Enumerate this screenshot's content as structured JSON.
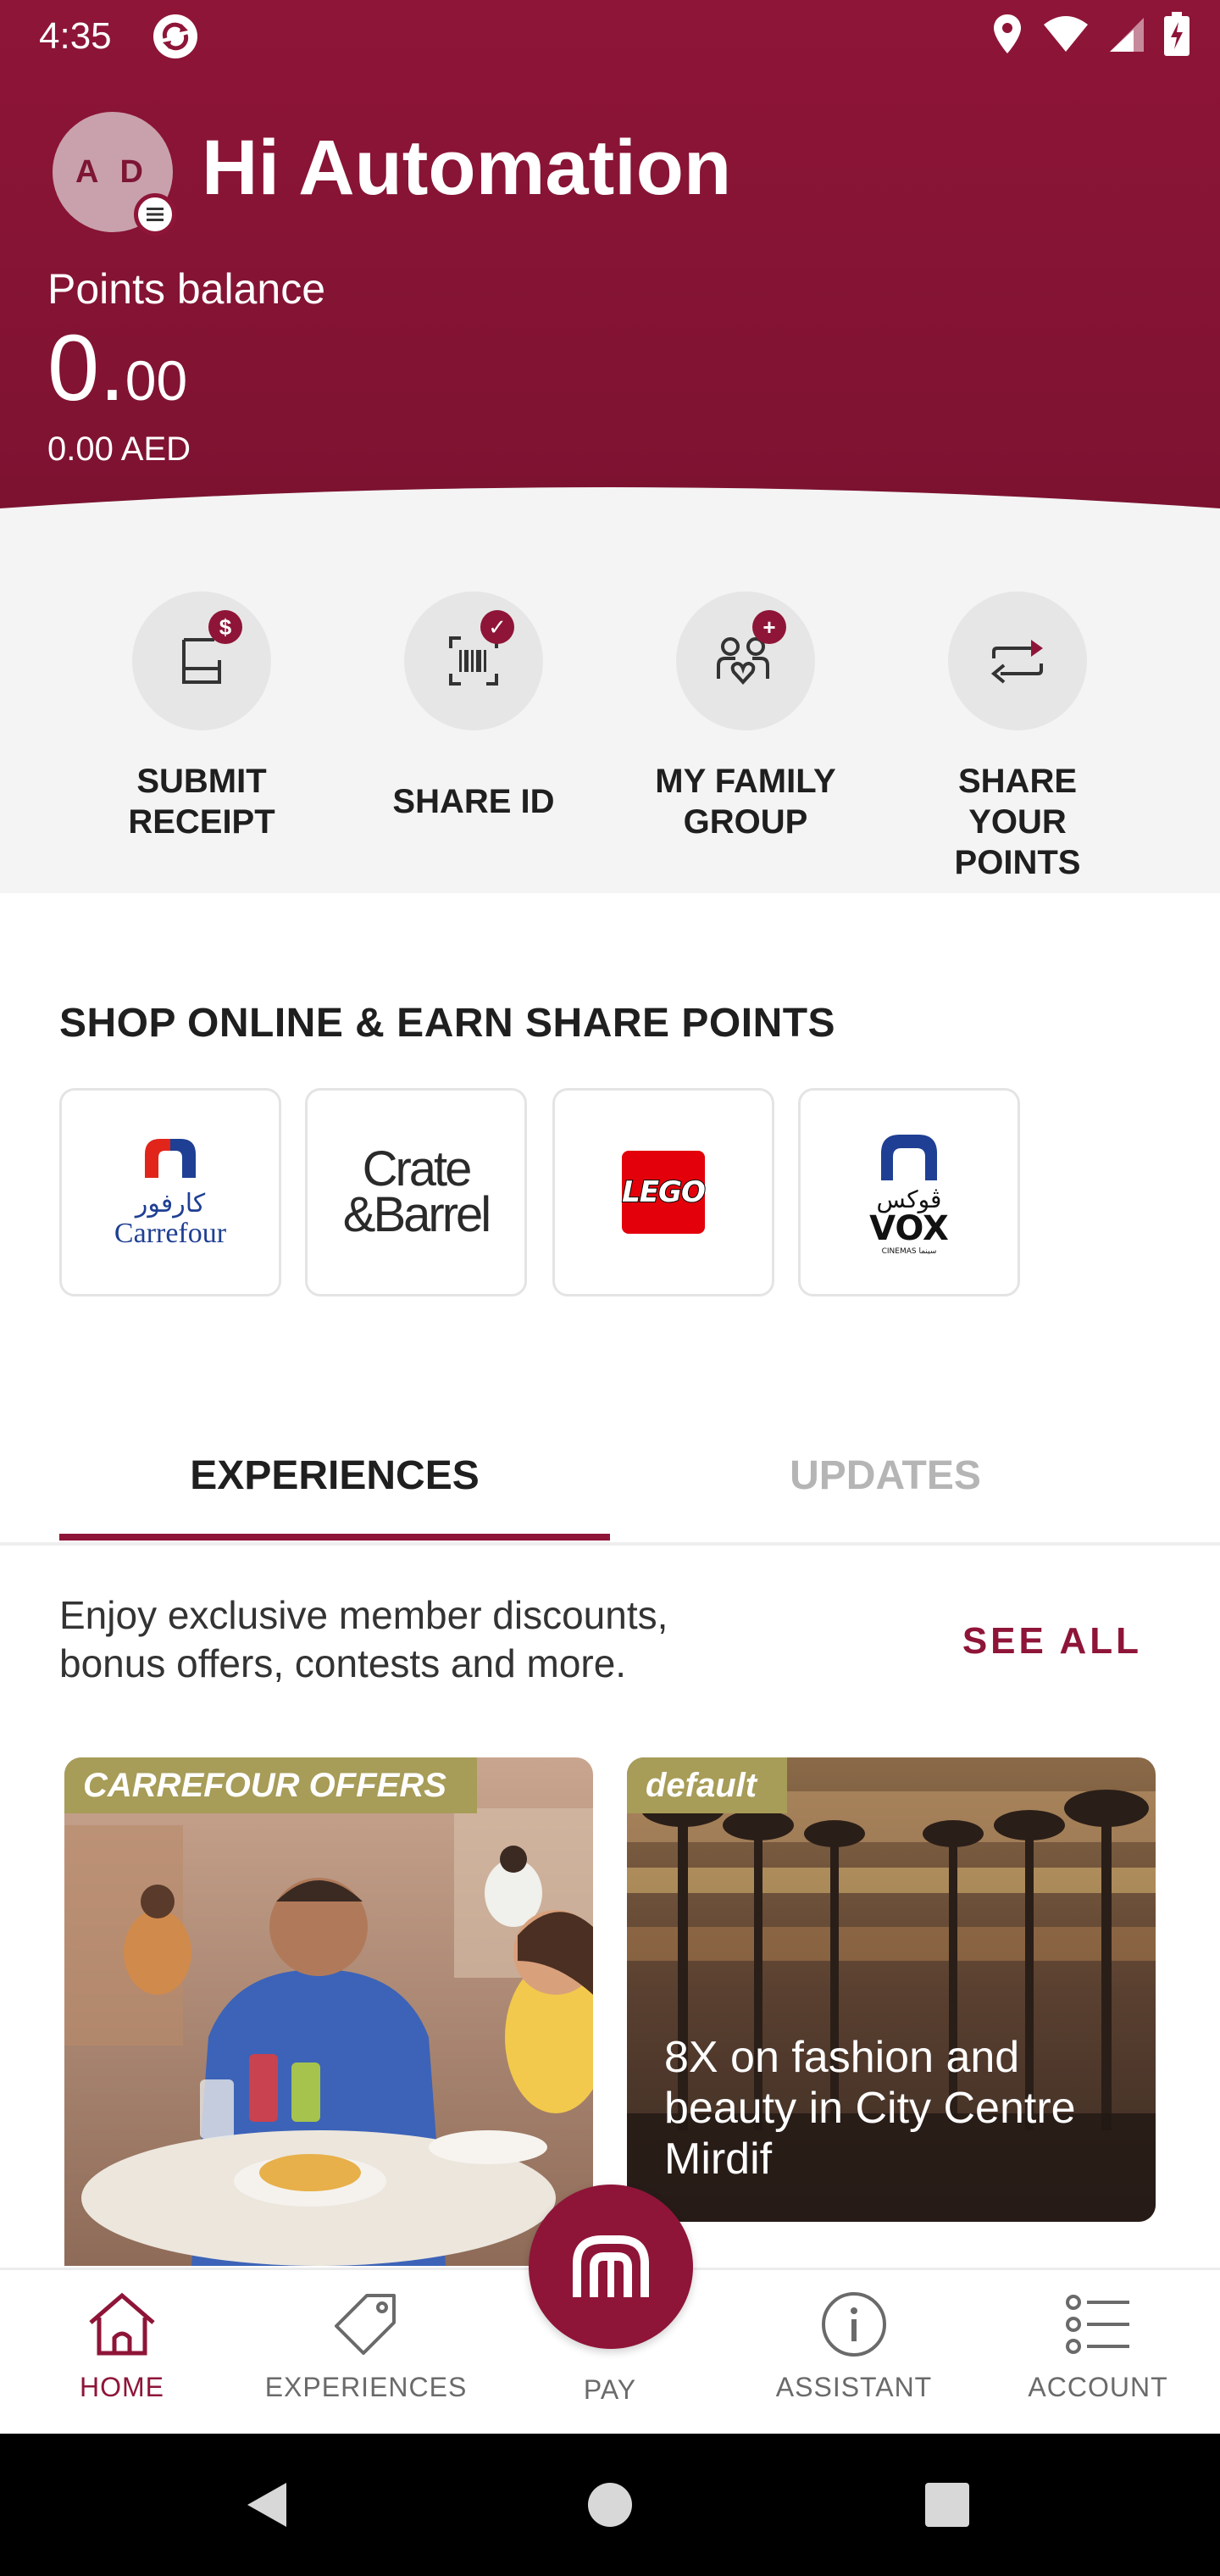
{
  "status_bar": {
    "time": "4:35"
  },
  "header": {
    "avatar_initials": "A D",
    "greeting": "Hi Automation",
    "points_label": "Points balance",
    "points_whole": "0.",
    "points_decimal": "00",
    "points_aed": "0.00 AED"
  },
  "actions": [
    {
      "label": "SUBMIT\nRECEIPT",
      "icon": "receipt-icon",
      "badge": "$"
    },
    {
      "label": "SHARE ID",
      "icon": "barcode-scan-icon",
      "badge": "✓"
    },
    {
      "label": "MY FAMILY\nGROUP",
      "icon": "family-icon",
      "badge": "+"
    },
    {
      "label": "SHARE YOUR\nPOINTS",
      "icon": "transfer-arrows-icon",
      "badge": ""
    }
  ],
  "shop": {
    "title": "SHOP ONLINE & EARN SHARE POINTS",
    "partners": [
      {
        "name": "Carrefour",
        "arabic": "كارفور"
      },
      {
        "name": "Crate&Barrel",
        "line1": "Crate",
        "line2": "&Barrel"
      },
      {
        "name": "LEGO"
      },
      {
        "name": "VOX",
        "arabic": "ڤوكس",
        "sub": "CINEMAS سينما"
      }
    ]
  },
  "tabs": {
    "active": "EXPERIENCES",
    "inactive": "UPDATES"
  },
  "experiences": {
    "description": "Enjoy exclusive member discounts, bonus offers, contests and more.",
    "see_all": "SEE ALL",
    "cards": [
      {
        "tag": "CARREFOUR OFFERS",
        "caption": ""
      },
      {
        "tag": "default",
        "caption": "8X on fashion and beauty in City Centre Mirdif"
      }
    ]
  },
  "bottom_nav": {
    "items": [
      {
        "label": "HOME",
        "active": true
      },
      {
        "label": "EXPERIENCES",
        "active": false
      },
      {
        "label": "PAY",
        "active": false
      },
      {
        "label": "ASSISTANT",
        "active": false
      },
      {
        "label": "ACCOUNT",
        "active": false
      }
    ]
  },
  "colors": {
    "brand": "#8e1538",
    "tag": "#a79c58",
    "lego_red": "#e3000b",
    "lego_yellow": "#ffd500",
    "carrefour_blue": "#1e3f93",
    "carrefour_red": "#e1251b"
  }
}
